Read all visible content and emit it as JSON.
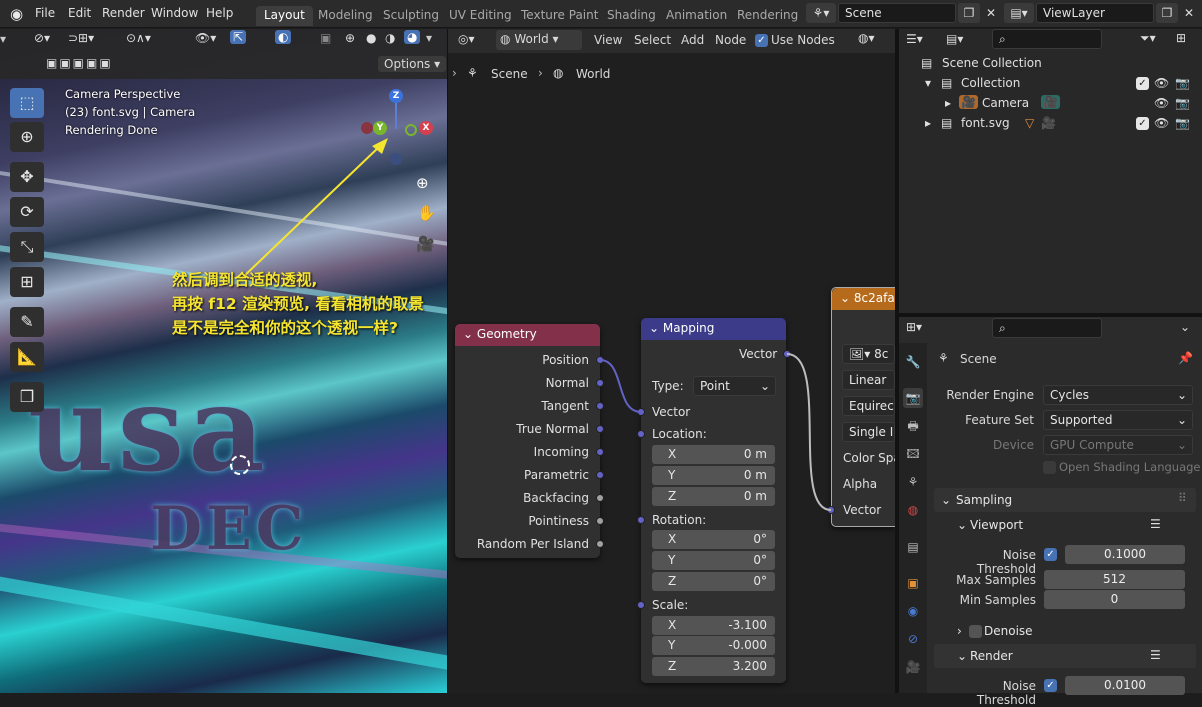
{
  "app": {
    "logo_icon": "blender-logo-icon"
  },
  "menu": [
    "File",
    "Edit",
    "Render",
    "Window",
    "Help"
  ],
  "workspaces": [
    "Layout",
    "Modeling",
    "Sculpting",
    "UV Editing",
    "Texture Paint",
    "Shading",
    "Animation",
    "Rendering"
  ],
  "active_workspace": "Layout",
  "scene_field": "Scene",
  "viewlayer_field": "ViewLayer",
  "viewport": {
    "options_label": "Options",
    "overlay_lines": [
      "Camera Perspective",
      "(23) font.svg | Camera",
      "Rendering Done"
    ],
    "annotation_lines": [
      "然后调到合适的透视,",
      "再按 f12 渲染预览, 看看相机的取景",
      "是不是完全和你的这个透视一样?"
    ],
    "scene_text_main": "usa",
    "scene_text_sub": "DEC",
    "gizmo_labels": {
      "z": "Z",
      "y": "Y",
      "x": "X"
    },
    "annotation_color": "#f6e52f"
  },
  "node_editor": {
    "world_dropdown": "World",
    "menu": [
      "View",
      "Select",
      "Add",
      "Node"
    ],
    "use_nodes_label": "Use Nodes",
    "breadcrumb": [
      "Scene",
      "World"
    ],
    "geometry_node": {
      "title": "Geometry",
      "header_color": "#83314a",
      "outputs": [
        "Position",
        "Normal",
        "Tangent",
        "True Normal",
        "Incoming",
        "Parametric",
        "Backfacing",
        "Pointiness",
        "Random Per Island"
      ]
    },
    "mapping_node": {
      "title": "Mapping",
      "header_color": "#3b3b8a",
      "output": "Vector",
      "type_label": "Type:",
      "type_value": "Point",
      "vector_input": "Vector",
      "location_label": "Location:",
      "location": [
        {
          "axis": "X",
          "value": "0 m"
        },
        {
          "axis": "Y",
          "value": "0 m"
        },
        {
          "axis": "Z",
          "value": "0 m"
        }
      ],
      "rotation_label": "Rotation:",
      "rotation": [
        {
          "axis": "X",
          "value": "0°"
        },
        {
          "axis": "Y",
          "value": "0°"
        },
        {
          "axis": "Z",
          "value": "0°"
        }
      ],
      "scale_label": "Scale:",
      "scale": [
        {
          "axis": "X",
          "value": "-3.100"
        },
        {
          "axis": "Y",
          "value": "-0.000"
        },
        {
          "axis": "Z",
          "value": "3.200"
        }
      ]
    },
    "image_node": {
      "title": "8c2afa",
      "header_color": "#b66a1b",
      "image_field": "8c",
      "interpolation": "Linear",
      "projection": "Equirect",
      "extension": "Single Im",
      "color_space": "Color Spa",
      "alpha": "Alpha",
      "vector_input": "Vector"
    }
  },
  "outliner": {
    "root": "Scene Collection",
    "rows": [
      {
        "label": "Collection",
        "indent": 1
      },
      {
        "label": "Camera",
        "indent": 2
      },
      {
        "label": "font.svg",
        "indent": 1
      }
    ]
  },
  "properties": {
    "context": "Scene",
    "render_engine_label": "Render Engine",
    "render_engine": "Cycles",
    "feature_set_label": "Feature Set",
    "feature_set": "Supported",
    "device_label": "Device",
    "device": "GPU Compute",
    "osl_label": "Open Shading Language",
    "sampling_label": "Sampling",
    "viewport_label": "Viewport",
    "noise_threshold_label": "Noise Threshold",
    "viewport_noise_threshold": "0.1000",
    "max_samples_label": "Max Samples",
    "max_samples": "512",
    "min_samples_label": "Min Samples",
    "min_samples": "0",
    "denoise_label": "Denoise",
    "render_label": "Render",
    "render_noise_threshold": "0.0100"
  },
  "colors": {
    "accent": "#4772b3",
    "vector_socket": "#6363c7",
    "float_socket": "#a1a1a1"
  }
}
